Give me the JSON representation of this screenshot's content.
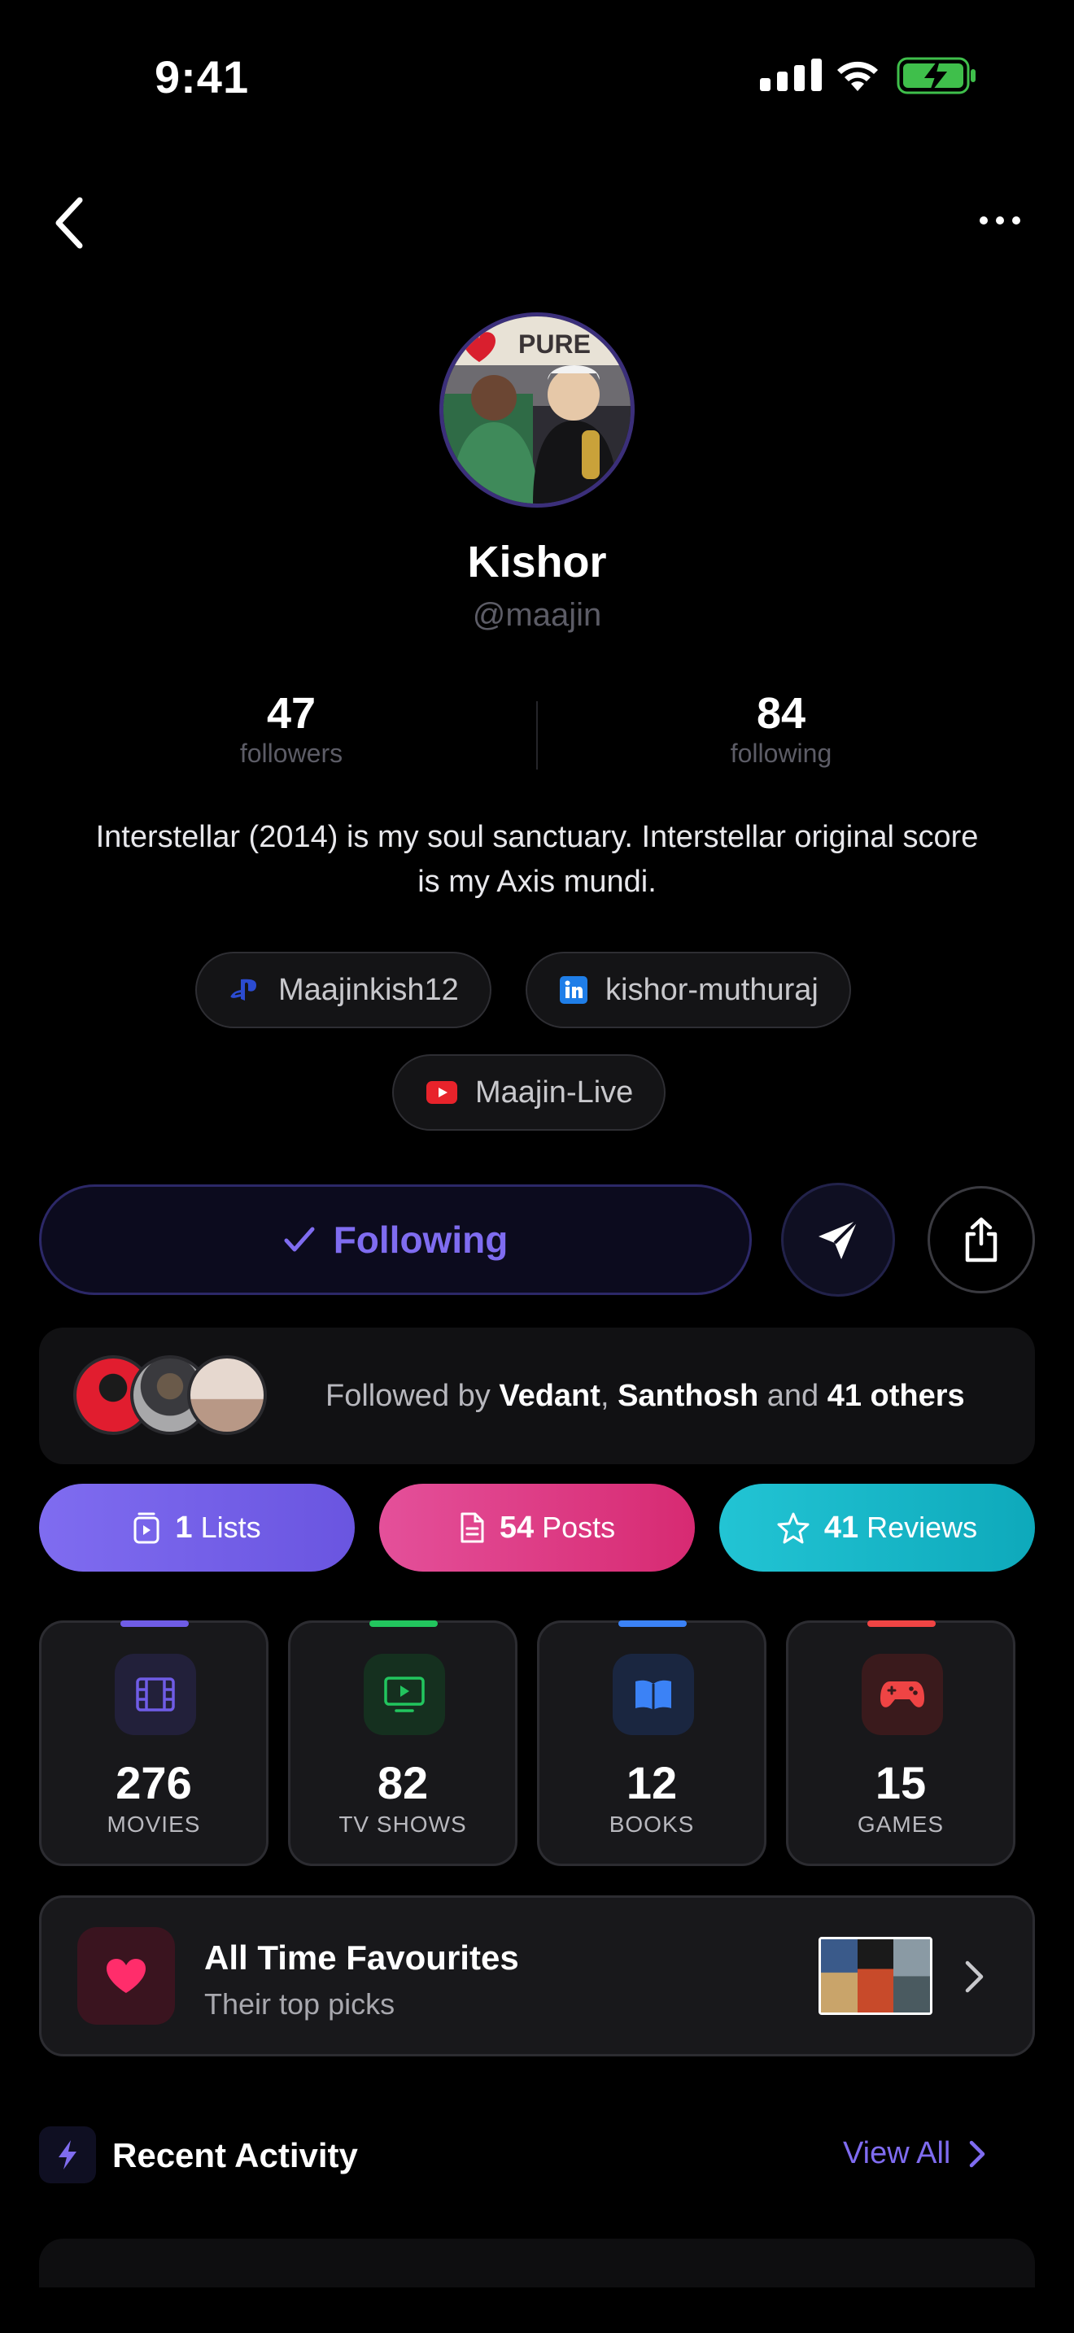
{
  "status_bar": {
    "time": "9:41"
  },
  "profile": {
    "name": "Kishor",
    "handle": "@maajin",
    "followers_count": "47",
    "followers_label": "followers",
    "following_count": "84",
    "following_label": "following",
    "bio": "Interstellar (2014) is my soul sanctuary. Interstellar original score is my Axis mundi.",
    "avatar_sign_text": "PURE"
  },
  "social_links": [
    {
      "platform": "playstation",
      "label": "Maajinkish12"
    },
    {
      "platform": "linkedin",
      "label": "kishor-muthuraj"
    },
    {
      "platform": "youtube",
      "label": "Maajin-Live"
    }
  ],
  "actions": {
    "following_label": "Following",
    "accent_color": "#7f6cf0"
  },
  "followed_by": {
    "prefix": "Followed by",
    "name1": "Vedant",
    "separator": ",",
    "name2": "Santhosh",
    "conj": "and",
    "others": "41 others"
  },
  "pills": [
    {
      "count": "1",
      "label": "Lists",
      "color": "#7a67ee"
    },
    {
      "count": "54",
      "label": "Posts",
      "color": "#e0468a"
    },
    {
      "count": "41",
      "label": "Reviews",
      "color": "#20c0d0"
    }
  ],
  "categories": [
    {
      "count": "276",
      "label": "MOVIES",
      "color": "#6f5ce6",
      "icon": "film-icon"
    },
    {
      "count": "82",
      "label": "TV SHOWS",
      "color": "#22c55e",
      "icon": "tv-icon"
    },
    {
      "count": "12",
      "label": "BOOKS",
      "color": "#3b82f6",
      "icon": "book-icon"
    },
    {
      "count": "15",
      "label": "GAMES",
      "color": "#ef4444",
      "icon": "gamepad-icon"
    }
  ],
  "favourites": {
    "title": "All Time Favourites",
    "subtitle": "Their top picks"
  },
  "recent_activity": {
    "title": "Recent Activity",
    "view_all": "View All"
  }
}
